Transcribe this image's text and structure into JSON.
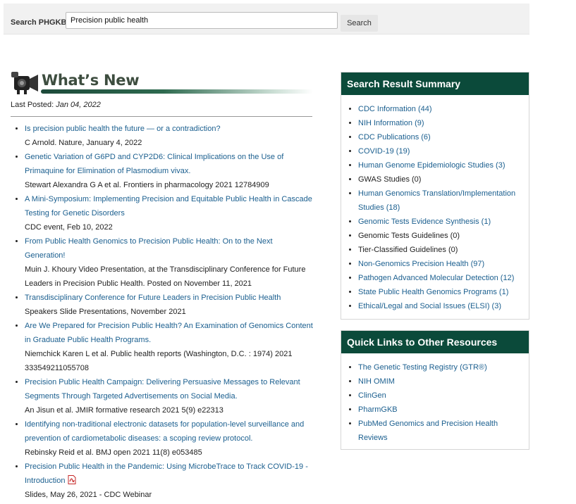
{
  "search": {
    "label": "Search PHGKB:",
    "value": "Precision public health",
    "button": "Search"
  },
  "whats_new": {
    "title": "What’s New",
    "last_posted_label": "Last Posted:",
    "last_posted_date": "Jan 04, 2022",
    "items": [
      {
        "title": "Is precision public health the future — or a contradiction?",
        "meta": "C Arnold. Nature, January 4, 2022"
      },
      {
        "title": "Genetic Variation of G6PD and CYP2D6: Clinical Implications on the Use of Primaquine for Elimination of Plasmodium vivax.",
        "meta": "Stewart Alexandra G A et al. Frontiers in pharmacology 2021 12784909"
      },
      {
        "title": "A Mini-Symposium: Implementing Precision and Equitable Public Health in Cascade Testing for Genetic Disorders",
        "meta": "CDC event, Feb 10, 2022"
      },
      {
        "title": "From Public Health Genomics to Precision Public Health: On to the Next Generation!",
        "meta": "Muin J. Khoury Video Presentation, at the Transdisciplinary Conference for Future Leaders in Precision Public Health. Posted on November 11, 2021"
      },
      {
        "title": "Transdisciplinary Conference for Future Leaders in Precision Public Health",
        "meta": "Speakers Slide Presentations, November 2021"
      },
      {
        "title": "Are We Prepared for Precision Public Health? An Examination of Genomics Content in Graduate Public Health Programs.",
        "meta": "Niemchick Karen L et al. Public health reports (Washington, D.C. : 1974) 2021 333549211055708"
      },
      {
        "title": "Precision Public Health Campaign: Delivering Persuasive Messages to Relevant Segments Through Targeted Advertisements on Social Media.",
        "meta": "An Jisun et al. JMIR formative research 2021 5(9) e22313"
      },
      {
        "title": "Identifying non-traditional electronic datasets for population-level surveillance and prevention of cardiometabolic diseases: a scoping review protocol.",
        "meta": "Rebinsky Reid et al. BMJ open 2021 11(8) e053485"
      },
      {
        "title": "Precision Public Health in the Pandemic: Using MicrobeTrace to Track COVID-19 - Introduction",
        "meta": "Slides, May 26, 2021 - CDC Webinar",
        "icon": "pdf-icon"
      }
    ]
  },
  "summary": {
    "title": "Search Result Summary",
    "items": [
      {
        "label": "CDC Information (44)",
        "link": true
      },
      {
        "label": "NIH Information (9)",
        "link": true
      },
      {
        "label": "CDC Publications (6)",
        "link": true
      },
      {
        "label": "COVID-19 (19)",
        "link": true
      },
      {
        "label": "Human Genome Epidemiologic Studies (3)",
        "link": true
      },
      {
        "label": "GWAS Studies (0)",
        "link": false
      },
      {
        "label": "Human Genomics Translation/Implementation Studies (18)",
        "link": true
      },
      {
        "label": "Genomic Tests Evidence Synthesis (1)",
        "link": true
      },
      {
        "label": "Genomic Tests Guidelines (0)",
        "link": false
      },
      {
        "label": "Tier-Classified Guidelines (0)",
        "link": false
      },
      {
        "label": "Non-Genomics Precision Health (97)",
        "link": true
      },
      {
        "label": "Pathogen Advanced Molecular Detection (12)",
        "link": true
      },
      {
        "label": "State Public Health Genomics Programs (1)",
        "link": true
      },
      {
        "label": "Ethical/Legal and Social Issues (ELSI) (3)",
        "link": true
      }
    ]
  },
  "quick_links": {
    "title": "Quick Links to Other Resources",
    "items": [
      "The Genetic Testing Registry (GTR®)",
      "NIH OMIM",
      "ClinGen",
      "PharmGKB",
      "PubMed Genomics and Precision Health Reviews"
    ]
  },
  "colors": {
    "panel_header": "#0b4a3a",
    "link": "#1b5f8f",
    "search_bar_bg": "#f1f1f1"
  }
}
